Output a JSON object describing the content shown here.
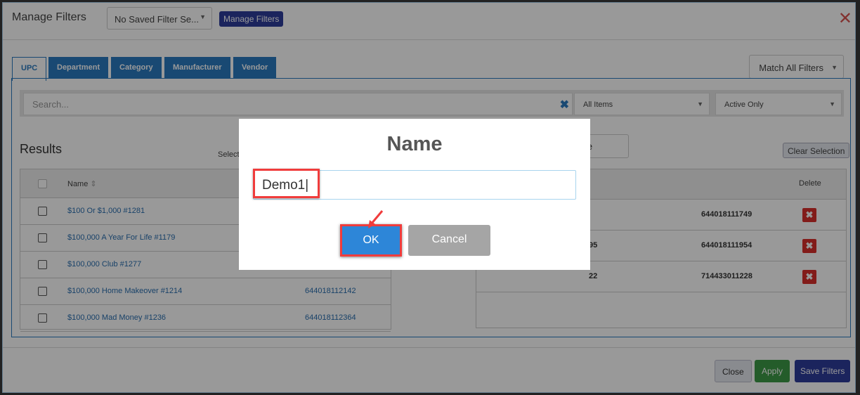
{
  "header": {
    "title": "Manage Filters",
    "saved_filter": "No Saved Filter Se...",
    "manage_filters_btn": "Manage Filters"
  },
  "tabs": [
    "UPC",
    "Department",
    "Category",
    "Manufacturer",
    "Vendor"
  ],
  "match_select": "Match All Filters",
  "search": {
    "placeholder": "Search...",
    "items_select": "All Items",
    "status_select": "Active Only"
  },
  "results": {
    "title": "Results",
    "select_label": "Select",
    "name_col": "Name",
    "rows": [
      {
        "name": "$100 Or $1,000 #1281",
        "upc": ""
      },
      {
        "name": "$100,000 A Year For Life #1179",
        "upc": ""
      },
      {
        "name": "$100,000 Club #1277",
        "upc": ""
      },
      {
        "name": "$100,000 Home Makeover #1214",
        "upc": "644018112142"
      },
      {
        "name": "$100,000 Mad Money #1236",
        "upc": "644018112364"
      }
    ]
  },
  "selected": {
    "include_btn": "Include",
    "clear_btn": "Clear Selection",
    "delete_col": "Delete",
    "rows": [
      {
        "frag": "",
        "upc": "644018111749"
      },
      {
        "frag": "95",
        "upc": "644018111954"
      },
      {
        "frag": "22",
        "upc": "714433011228"
      }
    ]
  },
  "footer": {
    "close": "Close",
    "apply": "Apply",
    "save": "Save Filters"
  },
  "dialog": {
    "title": "Name",
    "value": "Demo1",
    "ok": "OK",
    "cancel": "Cancel"
  }
}
